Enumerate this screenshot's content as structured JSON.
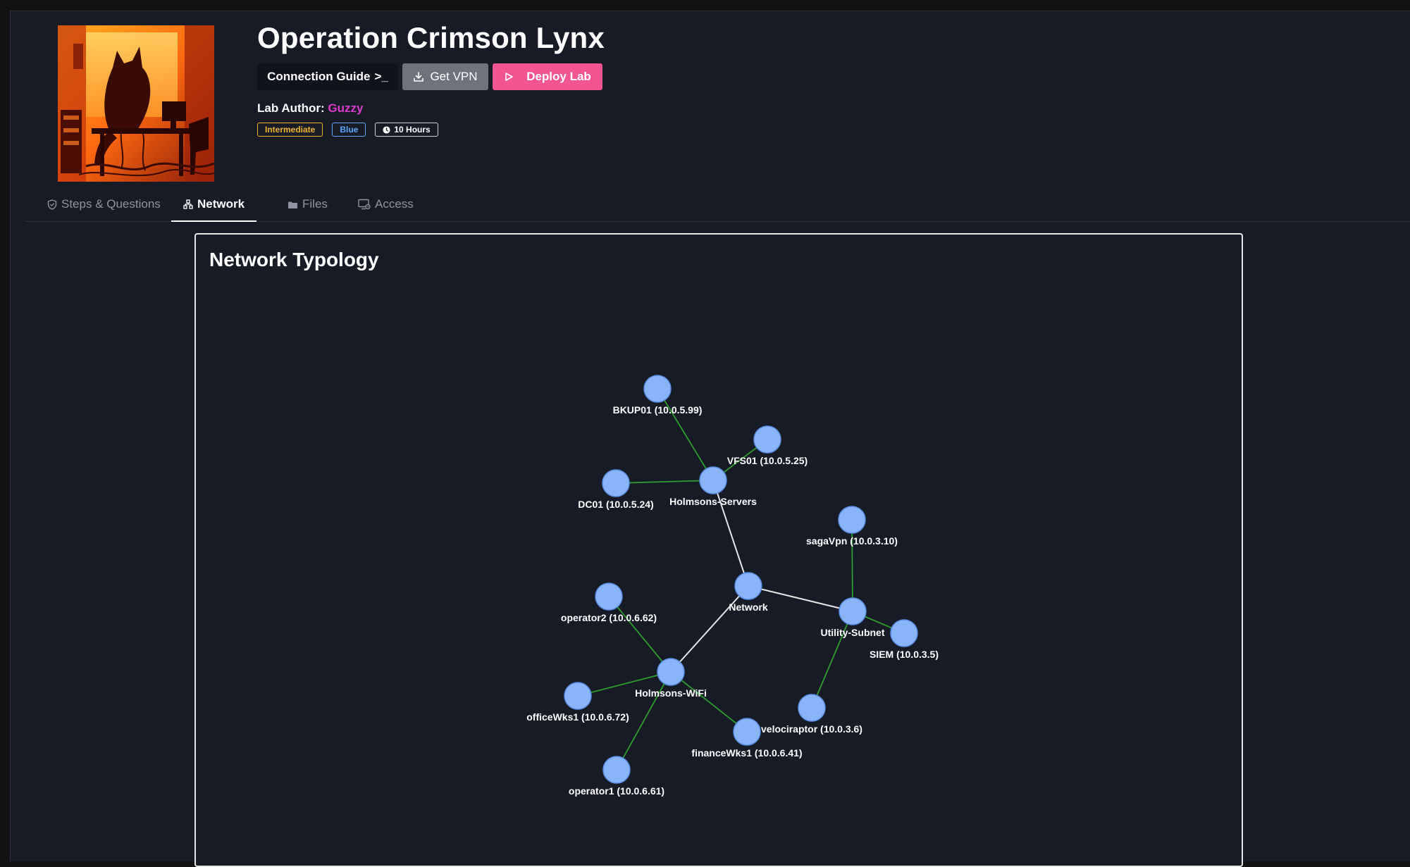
{
  "lab": {
    "title": "Operation Crimson Lynx",
    "author_prefix": "Lab Author:",
    "author_name": "Guzzy",
    "cover_alt_icon": "cat-silhouette-cover-art"
  },
  "actions": {
    "guide_label": "Connection Guide",
    "guide_suffix": ">_",
    "vpn_label": "Get VPN",
    "deploy_label": "Deploy Lab"
  },
  "badges": {
    "level": "Intermediate",
    "team": "Blue",
    "duration": "10 Hours"
  },
  "tabs": [
    {
      "label": "Steps & Questions",
      "icon": "shield-icon",
      "active": false
    },
    {
      "label": "Network",
      "icon": "network-icon",
      "active": true
    },
    {
      "label": "Files",
      "icon": "folder-icon",
      "active": false
    },
    {
      "label": "Access",
      "icon": "monitor-icon",
      "active": false
    }
  ],
  "panel": {
    "title": "Network Typology"
  },
  "colors": {
    "node_fill": "#8ab4f8",
    "link_core": "#e6e6e6",
    "link_subnet": "#2e9d2e",
    "accent_pink": "#f2558f",
    "author_pink": "#d93ccc"
  },
  "network": {
    "nodes": [
      {
        "id": "network",
        "label": "Network"
      },
      {
        "id": "holmsons-servers",
        "label": "Holmsons-Servers"
      },
      {
        "id": "utility-subnet",
        "label": "Utility-Subnet"
      },
      {
        "id": "holmsons-wifi",
        "label": "Holmsons-WiFi"
      },
      {
        "id": "bkup01",
        "label": "BKUP01 (10.0.5.99)"
      },
      {
        "id": "vfs01",
        "label": "VFS01 (10.0.5.25)"
      },
      {
        "id": "dc01",
        "label": "DC01 (10.0.5.24)"
      },
      {
        "id": "sagavpn",
        "label": "sagaVpn (10.0.3.10)"
      },
      {
        "id": "siem",
        "label": "SIEM (10.0.3.5)"
      },
      {
        "id": "velociraptor",
        "label": "velociraptor (10.0.3.6)"
      },
      {
        "id": "operator2",
        "label": "operator2 (10.0.6.62)"
      },
      {
        "id": "officewks1",
        "label": "officeWks1 (10.0.6.72)"
      },
      {
        "id": "financewks1",
        "label": "financeWks1 (10.0.6.41)"
      },
      {
        "id": "operator1",
        "label": "operator1 (10.0.6.61)"
      }
    ],
    "links": [
      {
        "source": "network",
        "target": "holmsons-servers",
        "kind": "core"
      },
      {
        "source": "network",
        "target": "utility-subnet",
        "kind": "core"
      },
      {
        "source": "network",
        "target": "holmsons-wifi",
        "kind": "core"
      },
      {
        "source": "holmsons-servers",
        "target": "bkup01",
        "kind": "subnet"
      },
      {
        "source": "holmsons-servers",
        "target": "vfs01",
        "kind": "subnet"
      },
      {
        "source": "holmsons-servers",
        "target": "dc01",
        "kind": "subnet"
      },
      {
        "source": "utility-subnet",
        "target": "sagavpn",
        "kind": "subnet"
      },
      {
        "source": "utility-subnet",
        "target": "siem",
        "kind": "subnet"
      },
      {
        "source": "utility-subnet",
        "target": "velociraptor",
        "kind": "subnet"
      },
      {
        "source": "holmsons-wifi",
        "target": "operator2",
        "kind": "subnet"
      },
      {
        "source": "holmsons-wifi",
        "target": "officewks1",
        "kind": "subnet"
      },
      {
        "source": "holmsons-wifi",
        "target": "financewks1",
        "kind": "subnet"
      },
      {
        "source": "holmsons-wifi",
        "target": "operator1",
        "kind": "subnet"
      }
    ]
  }
}
